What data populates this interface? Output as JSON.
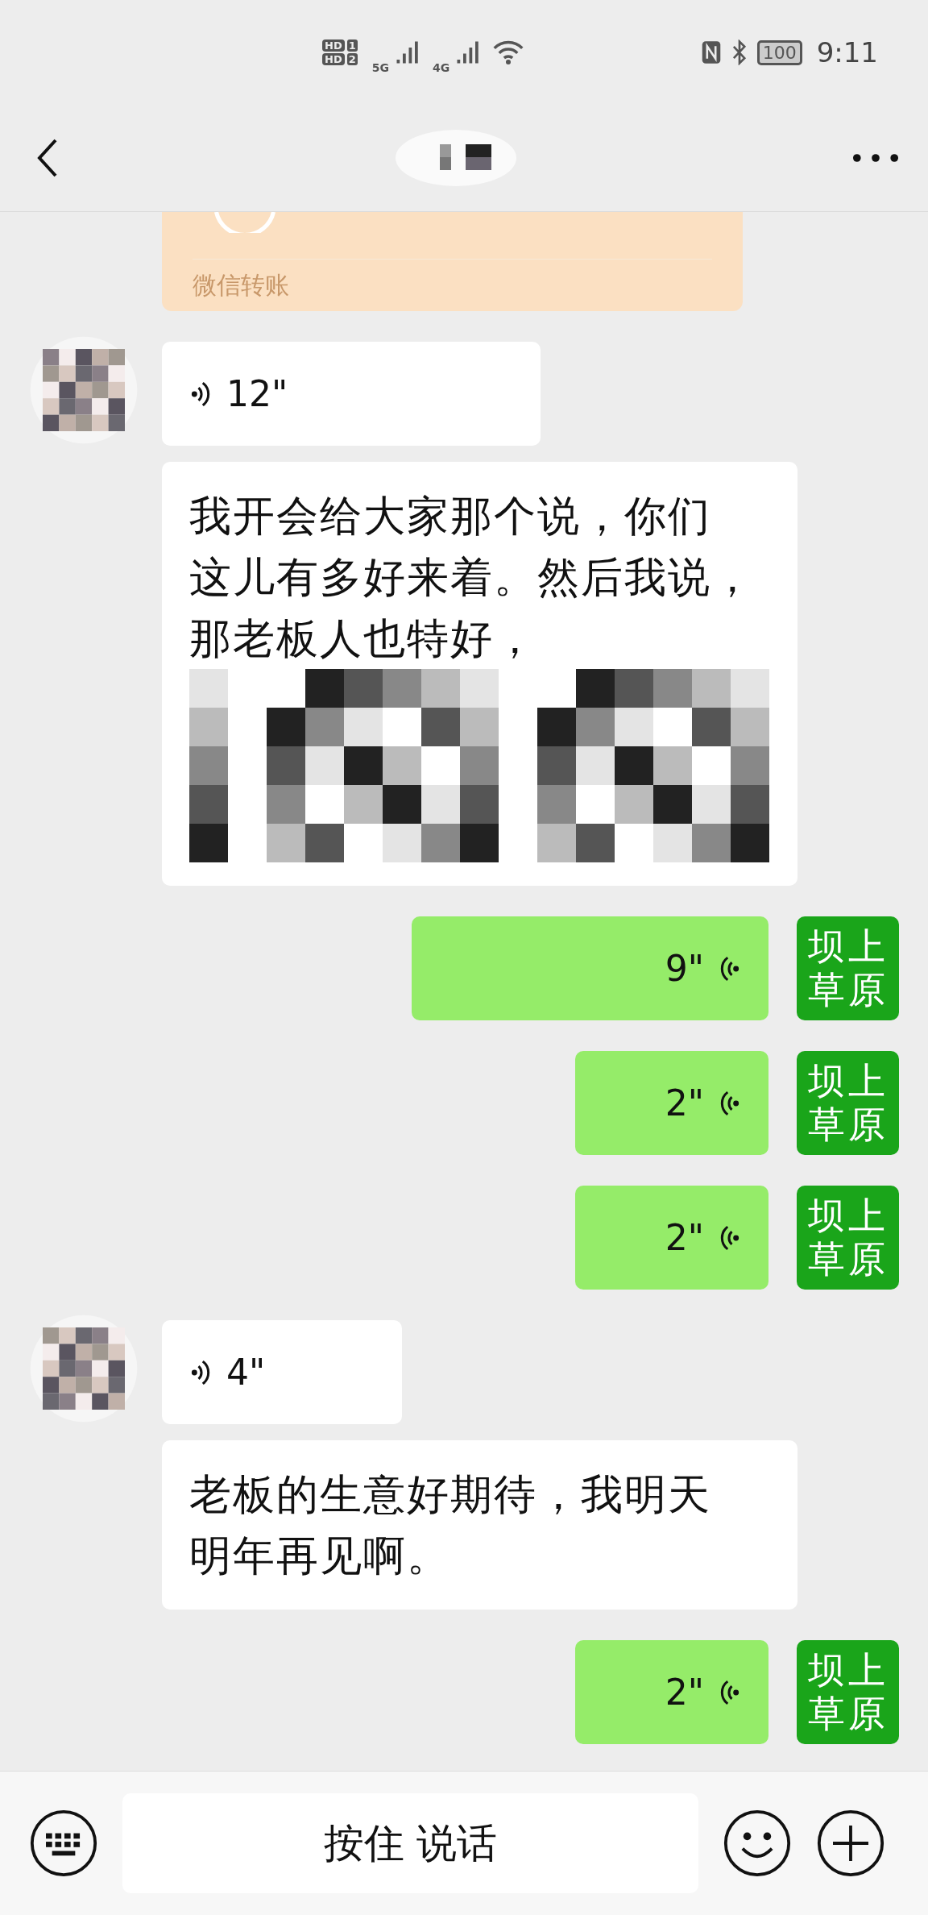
{
  "status_bar": {
    "hd_badges": [
      {
        "label": "HD",
        "slot": "1"
      },
      {
        "label": "HD",
        "slot": "2"
      }
    ],
    "networks": [
      "5G",
      "4G"
    ],
    "battery": "100",
    "time": "9:11"
  },
  "messages": [
    {
      "kind": "transfer",
      "sent": false,
      "label": "微信转账"
    },
    {
      "kind": "voice",
      "sent": false,
      "avatar": true,
      "duration": "12\""
    },
    {
      "kind": "text",
      "sent": false,
      "avatar": false,
      "lines": [
        "我开会给大家那个说，你们",
        "这儿有多好来着。然后我说，",
        "那老板人也特好，"
      ],
      "redacted": true
    },
    {
      "kind": "voice",
      "sent": true,
      "avatar_label": "坝上草原",
      "duration": "9\""
    },
    {
      "kind": "voice",
      "sent": true,
      "avatar_label": "坝上草原",
      "duration": "2\""
    },
    {
      "kind": "voice",
      "sent": true,
      "avatar_label": "坝上草原",
      "duration": "2\""
    },
    {
      "kind": "voice",
      "sent": false,
      "avatar": true,
      "duration": "4\""
    },
    {
      "kind": "text",
      "sent": false,
      "avatar": false,
      "lines": [
        "老板的生意好期待，我明天",
        "明年再见啊。"
      ],
      "redacted": false
    },
    {
      "kind": "voice",
      "sent": true,
      "avatar_label": "坝上草原",
      "duration": "2\""
    }
  ],
  "input_bar": {
    "hold_to_talk": "按住 说话"
  }
}
